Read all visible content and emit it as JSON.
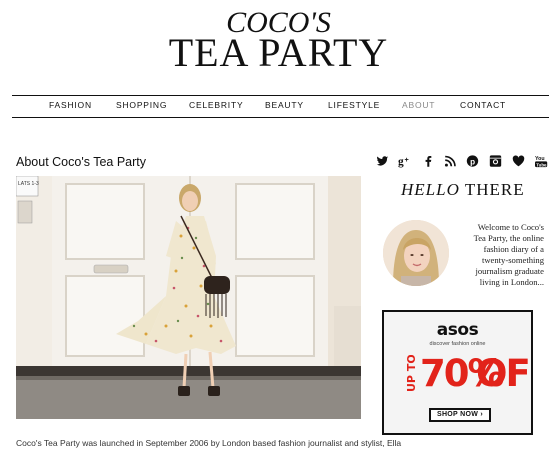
{
  "header": {
    "logo_line1": "COCO'S",
    "logo_line2": "TEA PARTY"
  },
  "nav": {
    "items": [
      {
        "label": "FASHION"
      },
      {
        "label": "SHOPPING"
      },
      {
        "label": "CELEBRITY"
      },
      {
        "label": "BEAUTY"
      },
      {
        "label": "LIFESTYLE"
      },
      {
        "label": "ABOUT",
        "active": true
      },
      {
        "label": "CONTACT"
      }
    ]
  },
  "main": {
    "title": "About Coco's Tea Party",
    "sign_text": "LATS 1-3",
    "intro_text": "Coco's Tea Party was launched in September 2006 by London based fashion journalist and stylist, Ella"
  },
  "social": {
    "icons": [
      "twitter-icon",
      "google-plus-icon",
      "facebook-icon",
      "rss-icon",
      "pinterest-icon",
      "instagram-icon",
      "bloglovin-heart-icon",
      "youtube-icon"
    ]
  },
  "sidebar": {
    "hello_italic": "HELLO",
    "hello_rest": "THERE",
    "welcome_lines": [
      "Welcome to Coco's",
      "Tea Party, the online",
      "fashion diary of a",
      "twenty-something",
      "journalism graduate",
      "living in London..."
    ]
  },
  "ad": {
    "brand": "asos",
    "tagline": "discover fashion online",
    "up_to": "UP TO",
    "percent": "70%",
    "off": "OFF",
    "cta": "SHOP NOW ›"
  },
  "colors": {
    "accent_red": "#e2231a",
    "nav_active": "#888888"
  }
}
